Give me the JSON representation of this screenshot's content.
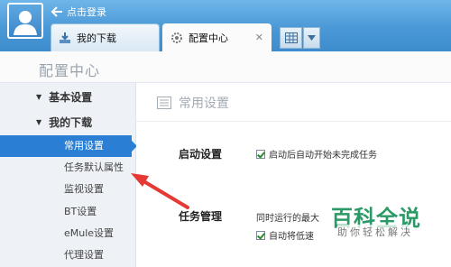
{
  "header": {
    "back_label": "点击登录",
    "view_toggle_icon": "grid-icon",
    "view_dropdown_icon": "chevron-down-icon"
  },
  "tabs": [
    {
      "label": "我的下载",
      "icon": "download-icon",
      "active": false
    },
    {
      "label": "配置中心",
      "icon": "gear-icon",
      "active": true,
      "close": "✕"
    }
  ],
  "page": {
    "title": "配置中心"
  },
  "sidebar": {
    "groups": [
      {
        "label": "基本设置",
        "expanded_icon": "triangle-down-icon"
      },
      {
        "label": "我的下载",
        "expanded_icon": "triangle-down-icon"
      }
    ],
    "items": [
      {
        "label": "常用设置",
        "selected": true
      },
      {
        "label": "任务默认属性"
      },
      {
        "label": "监视设置"
      },
      {
        "label": "BT设置"
      },
      {
        "label": "eMule设置"
      },
      {
        "label": "代理设置"
      }
    ]
  },
  "content": {
    "section_title": "常用设置",
    "section_icon": "list-icon",
    "startup": {
      "label": "启动设置",
      "option": "启动后自动开始未完成任务",
      "checked": true
    },
    "task_mgmt": {
      "label": "任务管理",
      "line1": "同时运行的最大",
      "option2": "自动将低速",
      "checked2": true
    }
  },
  "watermark": {
    "title": "百科全说",
    "subtitle": "助你轻松解决"
  },
  "colors": {
    "titlebar": "#4a98d6",
    "selection": "#2a7fd4",
    "annotation_arrow": "#e53935",
    "watermark_green": "#2b9a66"
  }
}
